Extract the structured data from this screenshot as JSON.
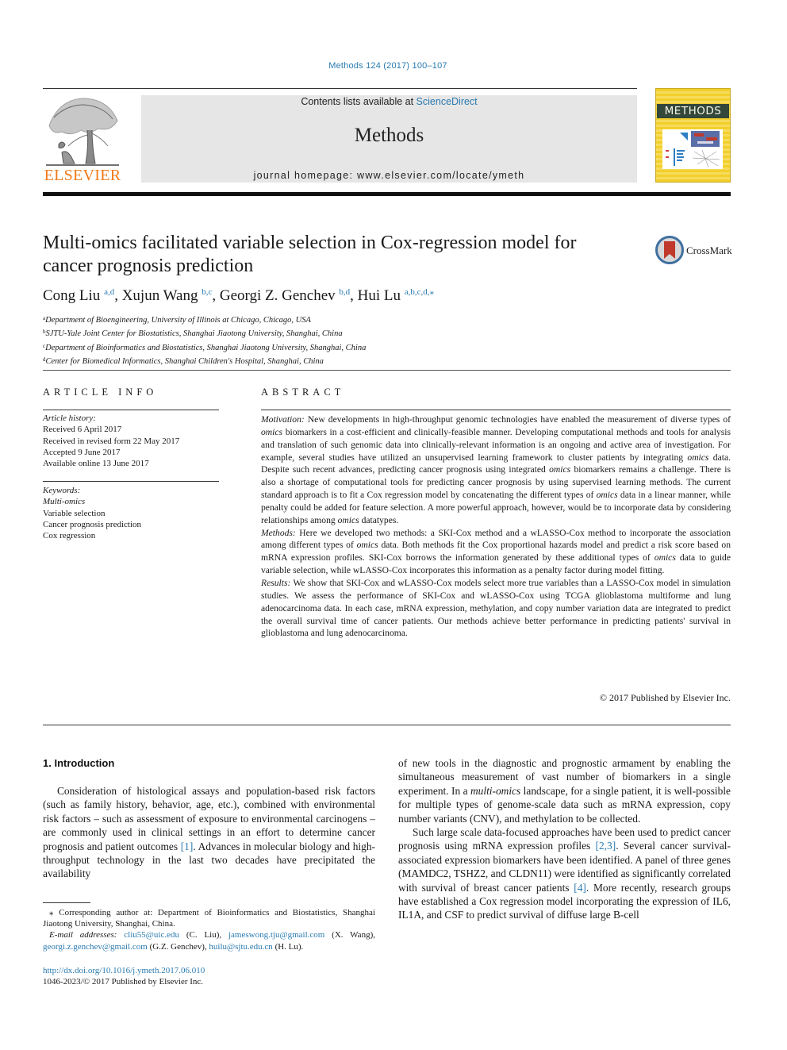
{
  "header": {
    "citation": "Methods 124 (2017) 100–107",
    "contents_prefix": "Contents lists available at ",
    "contents_link": "ScienceDirect",
    "journal_name": "Methods",
    "homepage_prefix": "journal homepage: ",
    "homepage_url": "www.elsevier.com/locate/ymeth",
    "publisher_logo_text": "ELSEVIER",
    "cover_title": "METHODS",
    "colors": {
      "link": "#2a7ab0",
      "elsevier_orange": "#f07a1a",
      "cover_yellow": "#f3cf2c",
      "cover_band": "#33473a",
      "banner_gray": "#e6e6e6"
    }
  },
  "article": {
    "title": "Multi-omics facilitated variable selection in Cox-regression model for cancer prognosis prediction",
    "crossmark_label": "CrossMark",
    "authors": [
      {
        "name": "Cong Liu",
        "sup": "a,d",
        "sep": ", "
      },
      {
        "name": "Xujun Wang",
        "sup": "b,c",
        "sep": ", "
      },
      {
        "name": "Georgi Z. Genchev",
        "sup": "b,d",
        "sep": ", "
      },
      {
        "name": "Hui Lu",
        "sup": "a,b,c,d,⁎",
        "sep": ""
      }
    ],
    "affiliations": [
      {
        "key": "a",
        "text": "Department of Bioengineering, University of Illinois at Chicago, Chicago, USA"
      },
      {
        "key": "b",
        "text": "SJTU-Yale Joint Center for Biostatistics, Shanghai Jiaotong University, Shanghai, China"
      },
      {
        "key": "c",
        "text": "Department of Bioinformatics and Biostatistics, Shanghai Jiaotong University, Shanghai, China"
      },
      {
        "key": "d",
        "text": "Center for Biomedical Informatics, Shanghai Children's Hospital, Shanghai, China"
      }
    ]
  },
  "article_info": {
    "heading": "ARTICLE INFO",
    "history_label": "Article history:",
    "history": [
      "Received 6 April 2017",
      "Received in revised form 22 May 2017",
      "Accepted 9 June 2017",
      "Available online 13 June 2017"
    ],
    "keywords_label": "Keywords:",
    "keywords": [
      "Multi-omics",
      "Variable selection",
      "Cancer prognosis prediction",
      "Cox regression"
    ]
  },
  "abstract": {
    "heading": "ABSTRACT",
    "motivation_label": "Motivation:",
    "motivation": [
      " New developments in high-throughput genomic technologies have enabled the measurement of diverse types of ",
      "omics",
      " biomarkers in a cost-efficient and clinically-feasible manner. Developing computational methods and tools for analysis and translation of such genomic data into clinically-relevant information is an ongoing and active area of investigation. For example, several studies have utilized an unsupervised learning framework to cluster patients by integrating ",
      "omics",
      " data. Despite such recent advances, predicting cancer prognosis using integrated ",
      "omics",
      " biomarkers remains a challenge. There is also a shortage of computational tools for predicting cancer prognosis by using supervised learning methods. The current standard approach is to fit a Cox regression model by concatenating the different types of ",
      "omics",
      " data in a linear manner, while penalty could be added for feature selection. A more powerful approach, however, would be to incorporate data by considering relationships among ",
      "omics",
      " datatypes."
    ],
    "methods_label": "Methods:",
    "methods": [
      "  Here we developed two methods: a SKI-Cox method and a wLASSO-Cox method to incorporate the association among different types of ",
      "omics",
      " data. Both methods fit the Cox proportional hazards model and predict a risk score based on mRNA expression profiles. SKI-Cox borrows the information generated by these additional types of ",
      "omics",
      " data to guide variable selection, while wLASSO-Cox incorporates this information as a penalty factor during model fitting."
    ],
    "results_label": "Results:",
    "results": " We show that SKI-Cox and wLASSO-Cox models select more true variables than a LASSO-Cox model in simulation studies. We assess the performance of SKI-Cox and wLASSO-Cox using TCGA glioblastoma multiforme and lung adenocarcinoma data. In each case, mRNA expression, methylation, and copy number variation data are integrated to predict the overall survival time of cancer patients. Our methods achieve better performance in predicting patients' survival in glioblastoma and lung adenocarcinoma.",
    "copyright": "© 2017 Published by Elsevier Inc."
  },
  "body": {
    "section_heading": "1. Introduction",
    "left_para": [
      "Consideration of histological assays and population-based risk factors (such as family history, behavior, age, etc.), combined with environmental risk factors – such as assessment of exposure to environmental carcinogens – are commonly used in clinical settings in an effort to determine cancer prognosis and patient outcomes ",
      "[1]",
      ". Advances in molecular biology and high-throughput technology in the last two decades have precipitated the availability"
    ],
    "right_para1": [
      "of new tools in the diagnostic and prognostic armament by enabling the simultaneous measurement of vast number of biomarkers in a single experiment. In a ",
      "multi-omics",
      " landscape, for a single patient, it is well-possible for multiple types of genome-scale data such as mRNA expression, copy number variants (CNV), and methylation to be collected."
    ],
    "right_para2": [
      "Such large scale data-focused approaches have been used to predict cancer prognosis using mRNA expression profiles ",
      "[2,3]",
      ". Several cancer survival-associated expression biomarkers have been identified. A panel of three genes (MAMDC2, TSHZ2, and CLDN11) were identified as significantly correlated with survival of breast cancer patients ",
      "[4]",
      ". More recently, research groups have established a Cox regression model incorporating the expression of IL6, IL1A, and CSF to predict survival of diffuse large B-cell"
    ]
  },
  "footnotes": {
    "corresponding": "⁎ Corresponding author at: Department of Bioinformatics and Biostatistics, Shanghai Jiaotong University, Shanghai, China.",
    "email_label": "E-mail addresses:",
    "emails": [
      {
        "email": "cliu55@uic.edu",
        "who": " (C. Liu), "
      },
      {
        "email": "jameswong.tju@gmail.com",
        "who": " (X. Wang), "
      },
      {
        "email": "georgi.z.genchev@gmail.com",
        "who": " (G.Z. Genchev), "
      },
      {
        "email": "huilu@sjtu.edu.cn",
        "who": " (H. Lu)."
      }
    ],
    "doi": "http://dx.doi.org/10.1016/j.ymeth.2017.06.010",
    "issn": "1046-2023/© 2017 Published by Elsevier Inc."
  }
}
